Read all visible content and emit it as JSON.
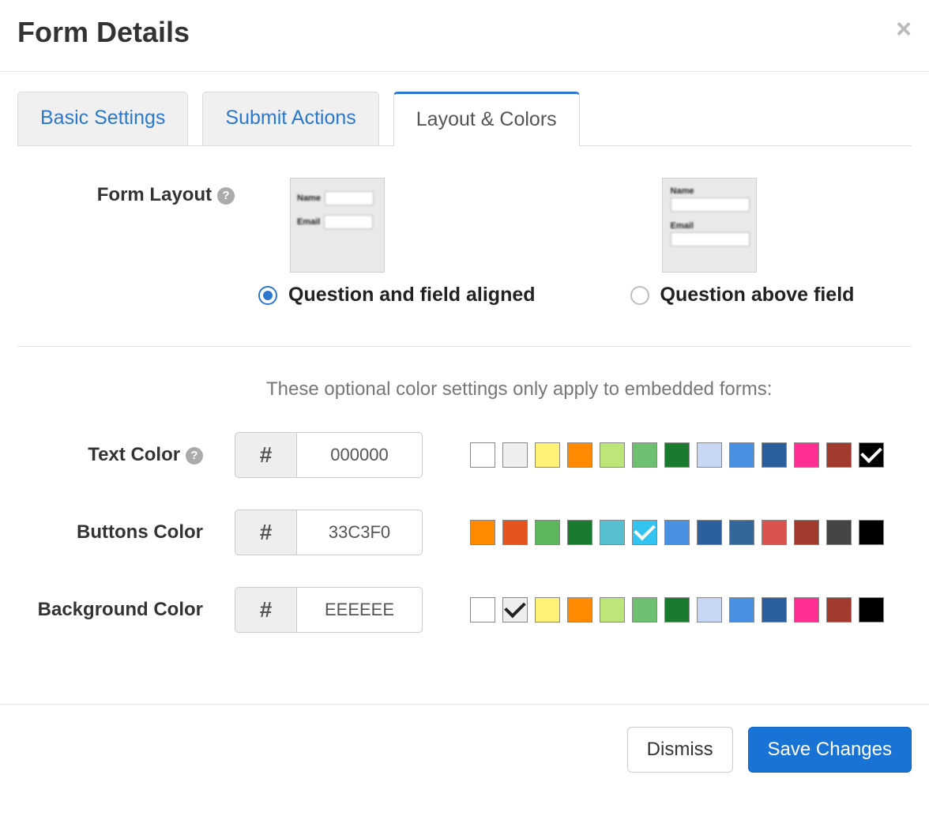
{
  "header": {
    "title": "Form Details"
  },
  "tabs": {
    "basic": "Basic Settings",
    "submit": "Submit Actions",
    "layout": "Layout & Colors",
    "active": "layout"
  },
  "formLayout": {
    "label": "Form Layout",
    "preview_name": "Name",
    "preview_email": "Email",
    "option_aligned": "Question and field aligned",
    "option_above": "Question above field",
    "selected": "aligned"
  },
  "colorsInfo": "These optional color settings only apply to embedded forms:",
  "hash": "#",
  "textColor": {
    "label": "Text Color",
    "value": "000000",
    "selected": "#000000",
    "swatches": [
      "#ffffff",
      "#eeeeee",
      "#fff176",
      "#ff8a00",
      "#bde57a",
      "#6ec070",
      "#1a7a2e",
      "#c9d7f7",
      "#4a90e2",
      "#2b5f9e",
      "#ff2e93",
      "#a23a2e",
      "#000000"
    ]
  },
  "buttonsColor": {
    "label": "Buttons Color",
    "value": "33C3F0",
    "selected": "#33C3F0",
    "swatches": [
      "#ff8a00",
      "#e5531f",
      "#5cb65c",
      "#1a7a2e",
      "#57c0d0",
      "#33c3f0",
      "#4a90e2",
      "#2b5f9e",
      "#336699",
      "#d9534f",
      "#a23a2e",
      "#444444",
      "#000000"
    ]
  },
  "backgroundColor": {
    "label": "Background Color",
    "value": "EEEEEE",
    "selected": "#eeeeee",
    "swatches": [
      "#ffffff",
      "#eeeeee",
      "#fff176",
      "#ff8a00",
      "#bde57a",
      "#6ec070",
      "#1a7a2e",
      "#c9d7f7",
      "#4a90e2",
      "#2b5f9e",
      "#ff2e93",
      "#a23a2e",
      "#000000"
    ]
  },
  "footer": {
    "dismiss": "Dismiss",
    "save": "Save Changes"
  }
}
